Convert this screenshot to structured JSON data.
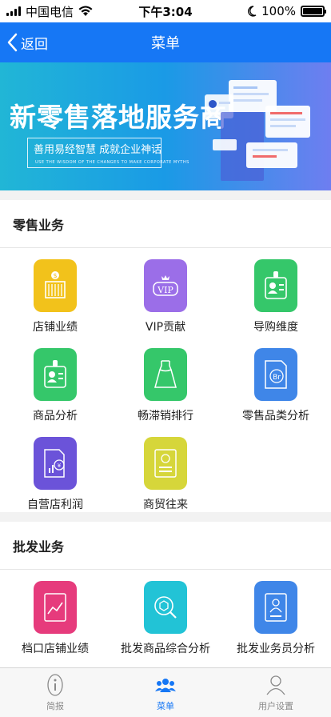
{
  "status": {
    "carrier": "中国电信",
    "time": "下午3:04",
    "battery": "100%"
  },
  "nav": {
    "back_label": "返回",
    "title": "菜单"
  },
  "banner": {
    "title": "新零售落地服务商",
    "subtitle": "善用易经智慧  成就企业神话",
    "tagline": "USE THE WISDOM OF THE CHANGES TO MAKE CORPORATE MYTHS"
  },
  "sections": [
    {
      "title": "零售业务",
      "items": [
        {
          "label": "店铺业绩",
          "icon": "store-icon",
          "color": "#f2c21b"
        },
        {
          "label": "VIP贡献",
          "icon": "vip-icon",
          "color": "#9b6ee8"
        },
        {
          "label": "导购维度",
          "icon": "guide-badge-icon",
          "color": "#35c76a"
        },
        {
          "label": "商品分析",
          "icon": "product-badge-icon",
          "color": "#35c76a"
        },
        {
          "label": "畅滞销排行",
          "icon": "dress-icon",
          "color": "#35c76a"
        },
        {
          "label": "零售品类分析",
          "icon": "category-doc-icon",
          "color": "#3f86e8"
        },
        {
          "label": "自营店利润",
          "icon": "profit-doc-icon",
          "color": "#6b53d9"
        },
        {
          "label": "商贸往来",
          "icon": "trade-doc-icon",
          "color": "#d6d63a"
        }
      ]
    },
    {
      "title": "批发业务",
      "items": [
        {
          "label": "档口店铺业绩",
          "icon": "chart-doc-icon",
          "color": "#e63b7c"
        },
        {
          "label": "批发商品综合分析",
          "icon": "box-search-icon",
          "color": "#22c3d6"
        },
        {
          "label": "批发业务员分析",
          "icon": "salesman-doc-icon",
          "color": "#3f86e8"
        }
      ]
    }
  ],
  "tabbar": [
    {
      "label": "简报",
      "icon": "info-icon"
    },
    {
      "label": "菜单",
      "icon": "group-icon"
    },
    {
      "label": "用户设置",
      "icon": "user-icon"
    }
  ],
  "colors": {
    "primary": "#1677f5",
    "active_tab": "#1677f5",
    "inactive_tab": "#8a8a8a"
  }
}
